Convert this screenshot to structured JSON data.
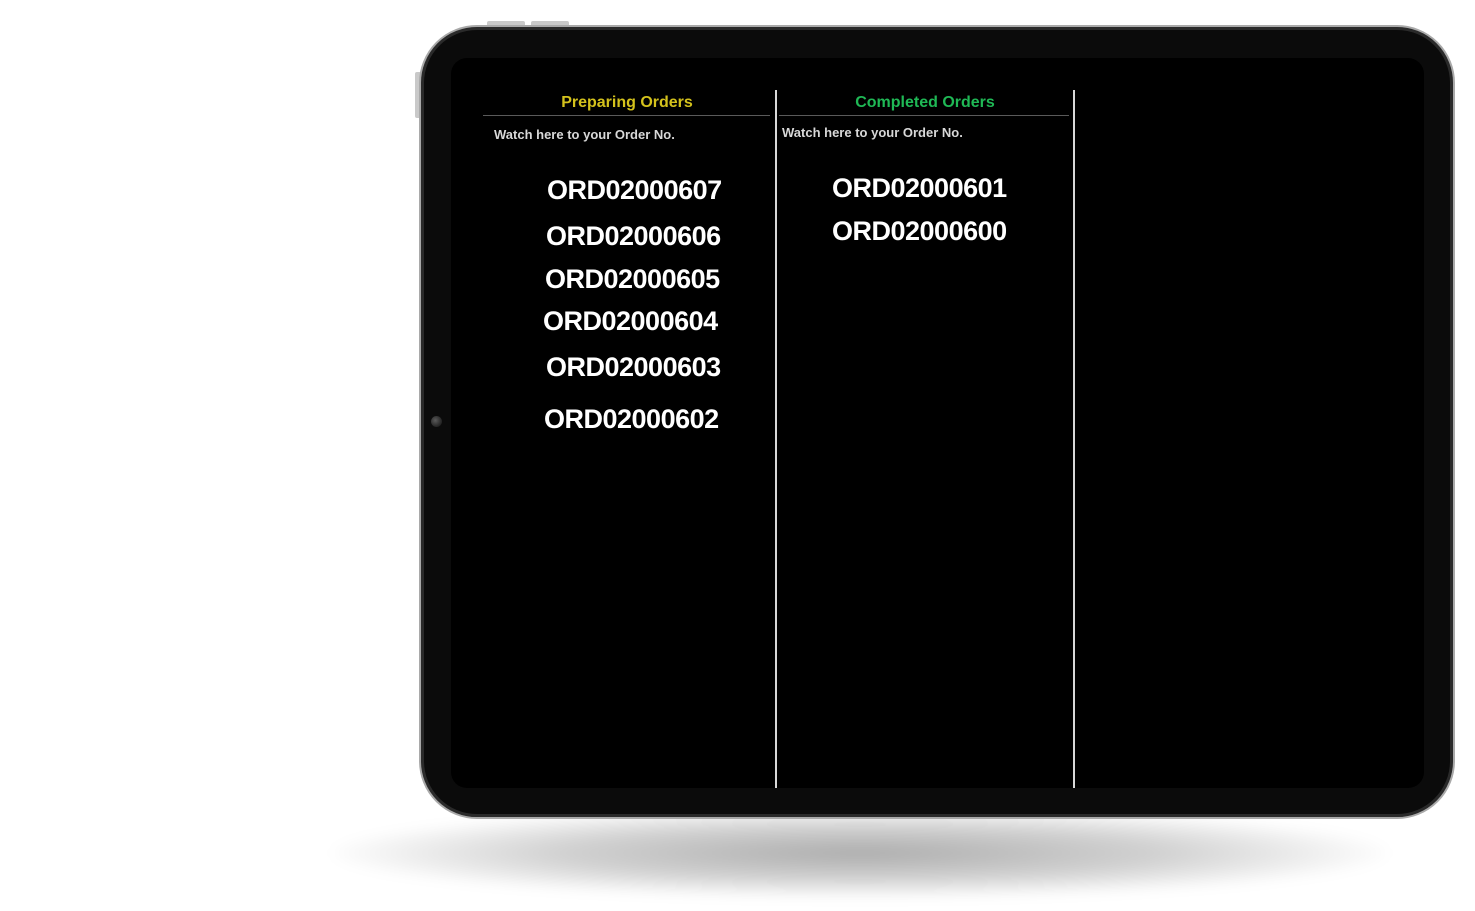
{
  "preparing": {
    "title": "Preparing Orders",
    "title_color": "#d4c21c",
    "subtitle": "Watch here to your Order No.",
    "orders": [
      "ORD02000607",
      "ORD02000606",
      "ORD02000605",
      "ORD02000604",
      "ORD02000603",
      "ORD02000602"
    ]
  },
  "completed": {
    "title": "Completed Orders",
    "title_color": "#1fb855",
    "subtitle": "Watch here to your Order No.",
    "orders": [
      "ORD02000601",
      "ORD02000600"
    ]
  },
  "colors": {
    "screen_background": "#000000",
    "order_text": "#ffffff",
    "divider": "#d9d9d9"
  }
}
